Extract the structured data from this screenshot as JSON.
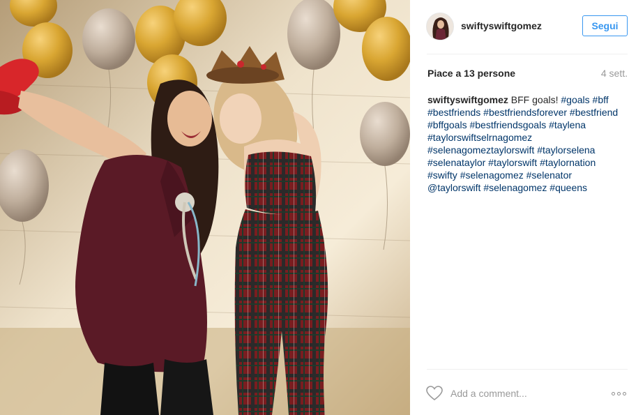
{
  "post": {
    "username": "swiftyswiftgomez",
    "follow_label": "Segui",
    "likes_text": "Piace a 13 persone",
    "time_ago": "4 sett.",
    "caption": {
      "username": "swiftyswiftgomez",
      "text": "BFF goals!",
      "tags": [
        "#goals",
        "#bff",
        "#bestfriends",
        "#bestfriendsforever",
        "#bestfriend",
        "#bffgoals",
        "#bestfriendsgoals",
        "#taylena",
        "#taylorswiftselrnagomez",
        "#selenagomeztaylorswift",
        "#taylorselena",
        "#selenataylor",
        "#taylorswift",
        "#taylornation",
        "#swifty",
        "#selenagomez",
        "#selenator",
        "@taylorswift",
        "#selenagomez",
        "#queens"
      ]
    },
    "comment_placeholder": "Add a comment..."
  },
  "icons": {
    "heart": "heart-icon",
    "more": "more-options-icon"
  },
  "colors": {
    "follow_blue": "#3897f0",
    "link": "#003569",
    "muted": "#999999",
    "text": "#262626"
  }
}
